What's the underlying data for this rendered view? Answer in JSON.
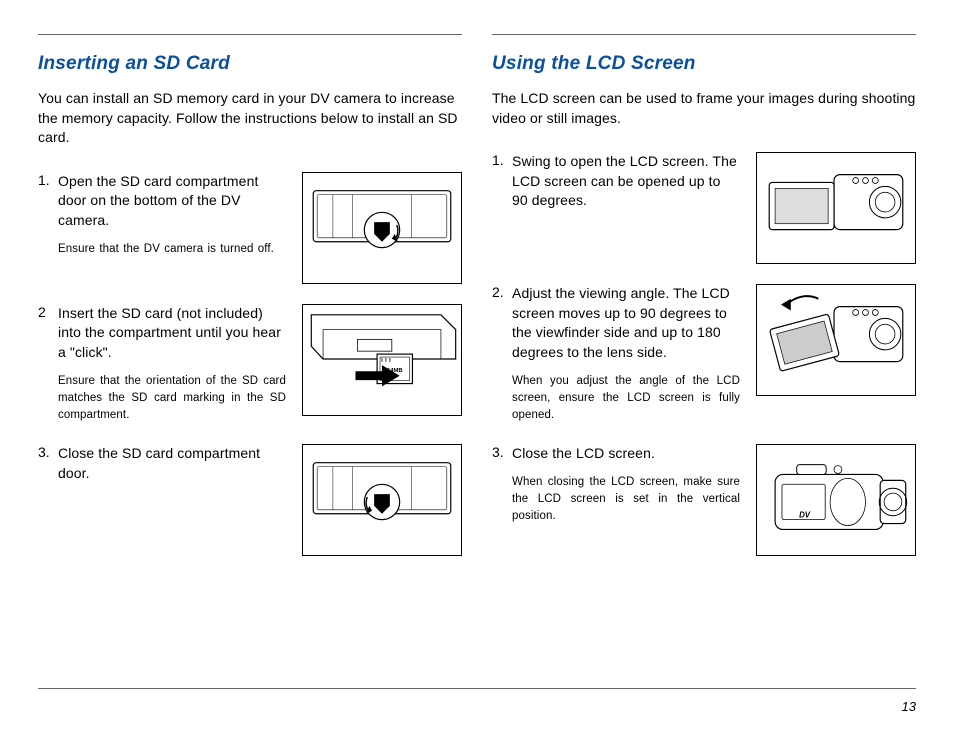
{
  "page_number": "13",
  "left": {
    "heading": "Inserting an SD Card",
    "intro": "You can install an SD memory card in your DV camera to increase the memory capacity. Follow the instructions below to install an SD card.",
    "steps": [
      {
        "num": "1.",
        "text": "Open the SD card compartment door on the bottom of the DV camera.",
        "note": "Ensure that the DV camera is turned off."
      },
      {
        "num": "2",
        "text": "Insert the SD card (not included) into the compartment until you hear a \"click\".",
        "note": "Ensure that the orientation of the SD card matches the SD card marking in the SD compartment."
      },
      {
        "num": "3.",
        "text": "Close the SD card compartment door.",
        "note": ""
      }
    ]
  },
  "right": {
    "heading": "Using the LCD Screen",
    "intro": "The LCD screen can be used to frame your images during shooting video or still images.",
    "steps": [
      {
        "num": "1.",
        "text": "Swing to open the LCD screen. The LCD screen can be opened up to 90 degrees.",
        "note": ""
      },
      {
        "num": "2.",
        "text": "Adjust the viewing angle. The LCD screen moves up to 90 degrees to the viewfinder side and up to 180 degrees to the lens side.",
        "note": "When you adjust the angle of the LCD screen, ensure the LCD screen is fully opened."
      },
      {
        "num": "3.",
        "text": "Close the LCD screen.",
        "note": "When closing the LCD screen, make sure the LCD screen is set in the vertical position."
      }
    ]
  }
}
